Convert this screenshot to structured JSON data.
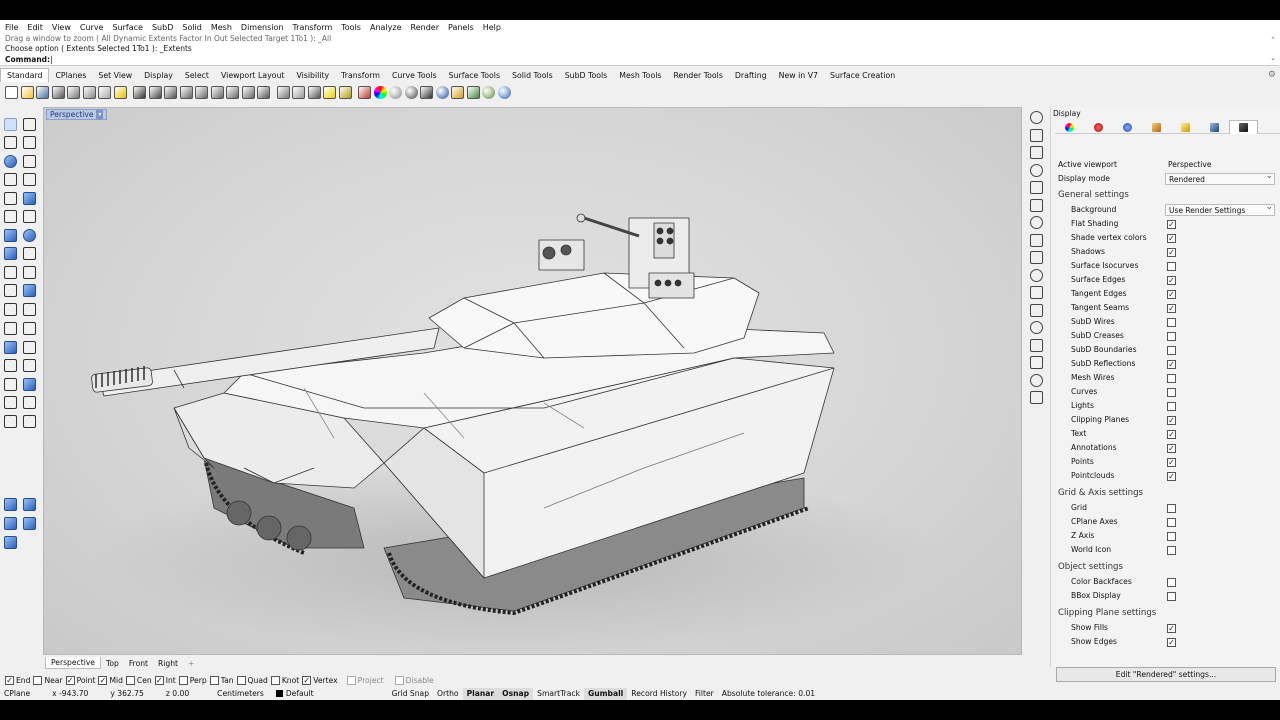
{
  "menubar": [
    "File",
    "Edit",
    "View",
    "Curve",
    "Surface",
    "SubD",
    "Solid",
    "Mesh",
    "Dimension",
    "Transform",
    "Tools",
    "Analyze",
    "Render",
    "Panels",
    "Help"
  ],
  "command": {
    "history_partial": "Drag a window to zoom ( All  Dynamic  Extents  Factor  In  Out  Selected  Target  1To1 ): _All",
    "history_last": "Choose option ( Extents  Selected  1To1 ): _Extents",
    "prompt": "Command:"
  },
  "toolbar_tabs": [
    "Standard",
    "CPlanes",
    "Set View",
    "Display",
    "Select",
    "Viewport Layout",
    "Visibility",
    "Transform",
    "Curve Tools",
    "Surface Tools",
    "Solid Tools",
    "SubD Tools",
    "Mesh Tools",
    "Render Tools",
    "Drafting",
    "New in V7",
    "Surface Creation"
  ],
  "toolbar_icons": [
    "new-icon",
    "open-icon",
    "save-icon",
    "print-icon",
    "import-icon",
    "cut-icon",
    "copy-icon",
    "paste-icon",
    "undo-icon",
    "pan-icon",
    "rotate-view-icon",
    "zoom-icon",
    "zoom-window-icon",
    "zoom-extents-icon",
    "zoom-selected-icon",
    "zoom-all-icon",
    "viewport-layout-icon",
    "car-icon",
    "cplane-icon",
    "named-view-icon",
    "light-icon",
    "lock-icon",
    "layer-icon",
    "color-wheel-icon",
    "render-sphere-icon",
    "shade-sphere-icon",
    "ghosted-icon",
    "rendered-sphere-icon",
    "cursor-options-icon",
    "properties-icon",
    "grasshopper-icon",
    "help-icon"
  ],
  "viewport": {
    "label": "Perspective",
    "tabs": [
      "Perspective",
      "Top",
      "Front",
      "Right"
    ],
    "add_tab": "+"
  },
  "panel": {
    "title": "Display",
    "tabs": [
      "color-wheel-icon",
      "materials-icon",
      "environment-icon",
      "brush-icon",
      "folder-icon",
      "render-settings-icon",
      "display-monitor-icon"
    ],
    "active_viewport_label": "Active viewport",
    "active_viewport_value": "Perspective",
    "display_mode_label": "Display mode",
    "display_mode_value": "Rendered",
    "sections": [
      {
        "title": "General settings",
        "rows": [
          {
            "label": "Background",
            "value": "Use Render Settings"
          },
          {
            "label": "Flat Shading",
            "checked": true
          },
          {
            "label": "Shade vertex colors",
            "checked": true
          },
          {
            "label": "Shadows",
            "checked": true
          },
          {
            "label": "Surface Isocurves",
            "checked": false
          },
          {
            "label": "Surface Edges",
            "checked": true
          },
          {
            "label": "Tangent Edges",
            "checked": true
          },
          {
            "label": "Tangent Seams",
            "checked": true
          },
          {
            "label": "SubD Wires",
            "checked": false
          },
          {
            "label": "SubD Creases",
            "checked": false
          },
          {
            "label": "SubD Boundaries",
            "checked": false
          },
          {
            "label": "SubD Reflections",
            "checked": true
          },
          {
            "label": "Mesh Wires",
            "checked": false
          },
          {
            "label": "Curves",
            "checked": false
          },
          {
            "label": "Lights",
            "checked": false
          },
          {
            "label": "Clipping Planes",
            "checked": true
          },
          {
            "label": "Text",
            "checked": true
          },
          {
            "label": "Annotations",
            "checked": true
          },
          {
            "label": "Points",
            "checked": true
          },
          {
            "label": "Pointclouds",
            "checked": true
          }
        ]
      },
      {
        "title": "Grid & Axis settings",
        "rows": [
          {
            "label": "Grid",
            "checked": false
          },
          {
            "label": "CPlane Axes",
            "checked": false
          },
          {
            "label": "Z Axis",
            "checked": false
          },
          {
            "label": "World Icon",
            "checked": false
          }
        ]
      },
      {
        "title": "Object settings",
        "rows": [
          {
            "label": "Color Backfaces",
            "checked": false
          },
          {
            "label": "BBox Display",
            "checked": false
          }
        ]
      },
      {
        "title": "Clipping Plane settings",
        "rows": [
          {
            "label": "Show Fills",
            "checked": true
          },
          {
            "label": "Show Edges",
            "checked": true
          }
        ]
      }
    ],
    "edit_button": "Edit \"Rendered\" settings..."
  },
  "osnaps": [
    {
      "label": "End",
      "checked": true
    },
    {
      "label": "Near",
      "checked": false
    },
    {
      "label": "Point",
      "checked": true
    },
    {
      "label": "Mid",
      "checked": true
    },
    {
      "label": "Cen",
      "checked": false
    },
    {
      "label": "Int",
      "checked": true
    },
    {
      "label": "Perp",
      "checked": false
    },
    {
      "label": "Tan",
      "checked": false
    },
    {
      "label": "Quad",
      "checked": false
    },
    {
      "label": "Knot",
      "checked": false
    },
    {
      "label": "Vertex",
      "checked": true
    },
    {
      "label": "Project",
      "checked": false,
      "disabled": true
    },
    {
      "label": "Disable",
      "checked": false,
      "disabled": true
    }
  ],
  "status": {
    "cplane": "CPlane",
    "x": "x -943.70",
    "y": "y 362.75",
    "z": "z 0.00",
    "units": "Centimeters",
    "layer": "Default",
    "grid_snap": "Grid Snap",
    "ortho": "Ortho",
    "planar": "Planar",
    "osnap": "Osnap",
    "smarttrack": "SmartTrack",
    "gumball": "Gumball",
    "record_history": "Record History",
    "filter": "Filter",
    "tolerance": "Absolute tolerance: 0.01"
  },
  "colors": {
    "accent": "#b9c9e8",
    "viewport_bg": "#d6d6d6",
    "model_white": "#f4f4f4"
  }
}
